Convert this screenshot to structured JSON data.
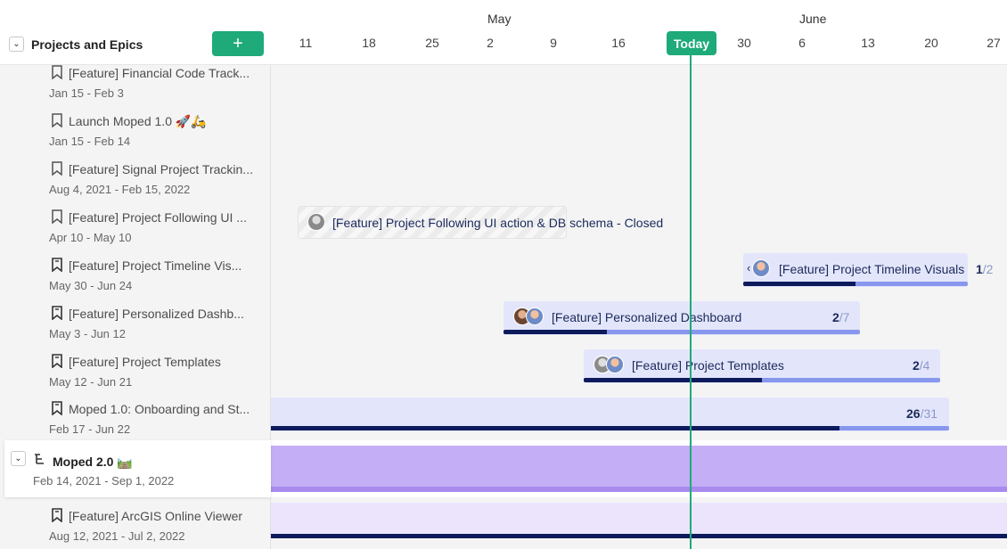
{
  "sidebar": {
    "title": "Projects and Epics",
    "add_label": "+",
    "items": [
      {
        "icon": "bookmark-outline-icon",
        "name": "[Feature] Financial Code Track...",
        "dates": "Jan 15 - Feb 3"
      },
      {
        "icon": "bookmark-outline-icon",
        "name": "Launch Moped 1.0 🚀🛵",
        "dates": "Jan 15 - Feb 14"
      },
      {
        "icon": "bookmark-outline-icon",
        "name": "[Feature] Signal Project Trackin...",
        "dates": "Aug 4, 2021 - Feb 15, 2022"
      },
      {
        "icon": "bookmark-outline-icon",
        "name": "[Feature] Project Following UI ...",
        "dates": "Apr 10 - May 10"
      },
      {
        "icon": "bookmark-icon",
        "name": "[Feature] Project Timeline Vis...",
        "dates": "May 30 - Jun 24"
      },
      {
        "icon": "bookmark-icon",
        "name": "[Feature] Personalized Dashb...",
        "dates": "May 3 - Jun 12"
      },
      {
        "icon": "bookmark-icon",
        "name": "[Feature] Project Templates",
        "dates": "May 12 - Jun 21"
      },
      {
        "icon": "bookmark-icon",
        "name": "Moped 1.0: Onboarding and St...",
        "dates": "Feb 17 - Jun 22"
      }
    ],
    "group": {
      "name": "Moped 2.0 🛤️",
      "dates": "Feb 14, 2021 - Sep 1, 2022"
    },
    "sub_item": {
      "name": "[Feature] ArcGIS Online Viewer",
      "dates": "Aug 12, 2021 - Jul 2, 2022"
    }
  },
  "timeline": {
    "months": [
      "May",
      "June"
    ],
    "days": [
      "11",
      "18",
      "25",
      "2",
      "9",
      "16",
      "30",
      "6",
      "13",
      "20",
      "27"
    ],
    "today_label": "Today",
    "bars": {
      "closed": {
        "label": "[Feature] Project Following UI action & DB schema - Closed"
      },
      "timeline_visuals": {
        "label": "[Feature] Project Timeline Visuals",
        "done": "1",
        "total": "/2",
        "progress": 0.5
      },
      "dashboard": {
        "label": "[Feature] Personalized Dashboard",
        "done": "2",
        "total": "/7",
        "progress": 0.29
      },
      "templates": {
        "label": "[Feature] Project Templates",
        "done": "2",
        "total": "/4",
        "progress": 0.5
      },
      "onboarding": {
        "done": "26",
        "total": "/31",
        "progress": 0.84
      }
    }
  },
  "colors": {
    "accent": "#1faa7a",
    "bar_bg": "#e3e6fa",
    "progress_dark": "#0d1b5c",
    "progress_light": "#8797ee",
    "group_bar": "#c4aef6",
    "group_bar_edge": "#a98bee",
    "sub_bar": "#ece4fc"
  }
}
